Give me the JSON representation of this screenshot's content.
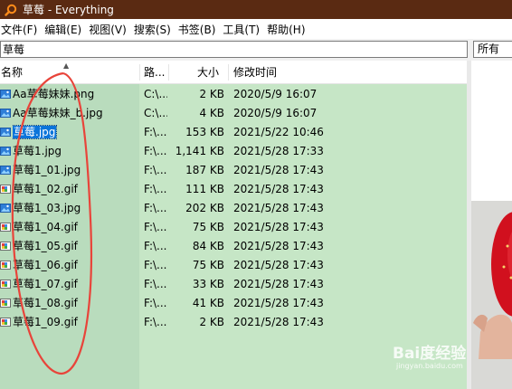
{
  "window": {
    "title": "草莓 - Everything"
  },
  "menu": [
    "文件(F)",
    "编辑(E)",
    "视图(V)",
    "搜索(S)",
    "书签(B)",
    "工具(T)",
    "帮助(H)"
  ],
  "search": {
    "value": "草莓",
    "filter": "所有"
  },
  "columns": {
    "name": "名称",
    "path": "路...",
    "size": "大小",
    "modified": "修改时间"
  },
  "files": [
    {
      "name": "Aa草莓妹妹.png",
      "path": "C:\\...",
      "size": "2 KB",
      "modified": "2020/5/9 16:07",
      "icon": "image-icon",
      "selected": false
    },
    {
      "name": "Aa草莓妹妹_b.jpg",
      "path": "C:\\...",
      "size": "4 KB",
      "modified": "2020/5/9 16:07",
      "icon": "image-icon",
      "selected": false
    },
    {
      "name": "草莓.jpg",
      "path": "F:\\...",
      "size": "153 KB",
      "modified": "2021/5/22 10:46",
      "icon": "image-icon",
      "selected": true
    },
    {
      "name": "草莓1.jpg",
      "path": "F:\\...",
      "size": "1,141 KB",
      "modified": "2021/5/28 17:33",
      "icon": "image-icon",
      "selected": false
    },
    {
      "name": "草莓1_01.jpg",
      "path": "F:\\...",
      "size": "187 KB",
      "modified": "2021/5/28 17:43",
      "icon": "image-icon",
      "selected": false
    },
    {
      "name": "草莓1_02.gif",
      "path": "F:\\...",
      "size": "111 KB",
      "modified": "2021/5/28 17:43",
      "icon": "gif-icon",
      "selected": false
    },
    {
      "name": "草莓1_03.jpg",
      "path": "F:\\...",
      "size": "202 KB",
      "modified": "2021/5/28 17:43",
      "icon": "image-icon",
      "selected": false
    },
    {
      "name": "草莓1_04.gif",
      "path": "F:\\...",
      "size": "75 KB",
      "modified": "2021/5/28 17:43",
      "icon": "gif-icon",
      "selected": false
    },
    {
      "name": "草莓1_05.gif",
      "path": "F:\\...",
      "size": "84 KB",
      "modified": "2021/5/28 17:43",
      "icon": "gif-icon",
      "selected": false
    },
    {
      "name": "草莓1_06.gif",
      "path": "F:\\...",
      "size": "75 KB",
      "modified": "2021/5/28 17:43",
      "icon": "gif-icon",
      "selected": false
    },
    {
      "name": "草莓1_07.gif",
      "path": "F:\\...",
      "size": "33 KB",
      "modified": "2021/5/28 17:43",
      "icon": "gif-icon",
      "selected": false
    },
    {
      "name": "草莓1_08.gif",
      "path": "F:\\...",
      "size": "41 KB",
      "modified": "2021/5/28 17:43",
      "icon": "gif-icon",
      "selected": false
    },
    {
      "name": "草莓1_09.gif",
      "path": "F:\\...",
      "size": "2 KB",
      "modified": "2021/5/28 17:43",
      "icon": "gif-icon",
      "selected": false
    }
  ],
  "watermark": {
    "logo": "Bai度经验",
    "url": "jingyan.baidu.com"
  },
  "colors": {
    "titlebar": "#5a2a12",
    "list_bg": "#c6e6c6",
    "selection": "#0a74da",
    "annotation": "#e8443a"
  }
}
